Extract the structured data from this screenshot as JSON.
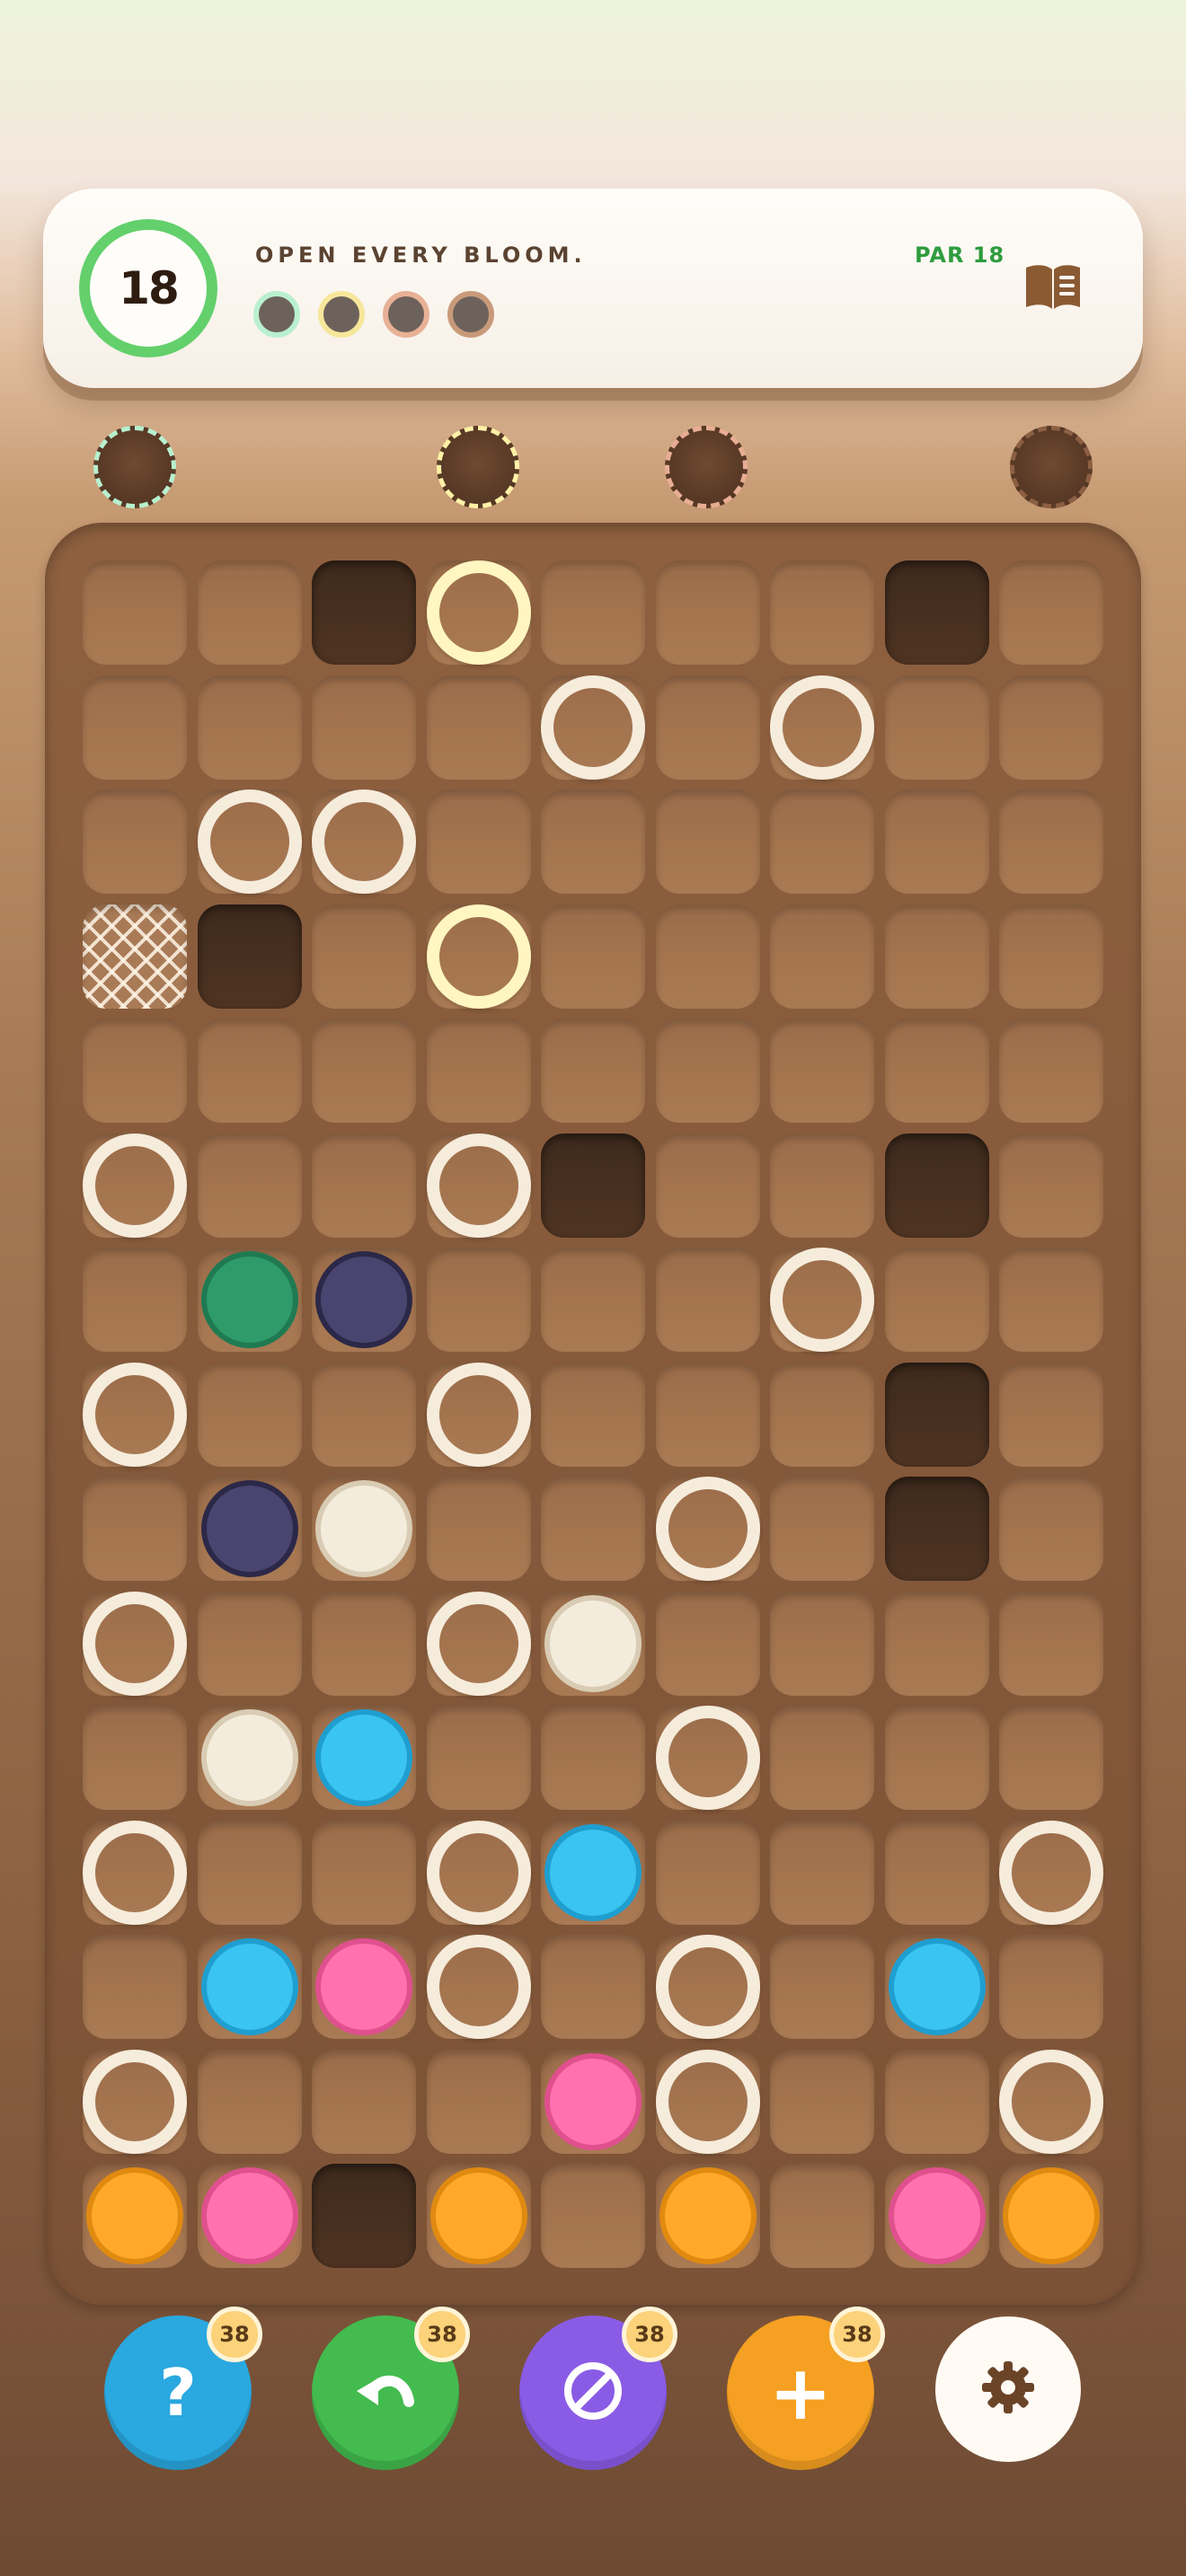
{
  "header": {
    "moves_left": "18",
    "goal_text": "OPEN EVERY BLOOM.",
    "par_text": "PAR 18"
  },
  "goal_dots": [
    {
      "border": "#b9f0cf"
    },
    {
      "border": "#f6e79a"
    },
    {
      "border": "#e8b196"
    },
    {
      "border": "#c89a7a"
    }
  ],
  "seed_slots": [
    {
      "border": "#b7f0cf"
    },
    {
      "border": "#fff1a6"
    },
    {
      "border": "#e8ad94"
    },
    {
      "border": "#8c5f43"
    }
  ],
  "colors": {
    "green_bloom": "#2f9a6a",
    "navy_bloom": "#4a4470",
    "cream_bloom": "#f3ecdd",
    "blue_bloom": "#3ac4f0",
    "pink_bloom": "#ff72ad",
    "orange_bloom": "#ffa92a",
    "ring": "#f6ecdc",
    "gold_ring": "#fff6c2"
  },
  "board": {
    "cols": 9,
    "rows": 15,
    "cells": [
      [
        "e",
        "e",
        "R",
        "G",
        "e",
        "e",
        "e",
        "R",
        "e"
      ],
      [
        "e",
        "e",
        "e",
        "e",
        "r",
        "e",
        "r",
        "e",
        "e"
      ],
      [
        "e",
        "r",
        "r",
        "e",
        "e",
        "e",
        "e",
        "e",
        "e"
      ],
      [
        "N",
        "R",
        "e",
        "G",
        "e",
        "e",
        "e",
        "e",
        "e"
      ],
      [
        "e",
        "e",
        "e",
        "e",
        "e",
        "e",
        "e",
        "e",
        "e"
      ],
      [
        "r",
        "e",
        "e",
        "r",
        "R",
        "e",
        "e",
        "R",
        "e"
      ],
      [
        "e",
        "green",
        "navy",
        "e",
        "e",
        "e",
        "r",
        "e",
        "e"
      ],
      [
        "r",
        "e",
        "e",
        "r",
        "e",
        "e",
        "e",
        "R",
        "e"
      ],
      [
        "e",
        "navy",
        "cream",
        "e",
        "e",
        "r",
        "e",
        "R",
        "e"
      ],
      [
        "r",
        "e",
        "e",
        "r",
        "cream",
        "e",
        "e",
        "e",
        "e"
      ],
      [
        "e",
        "cream",
        "blue",
        "e",
        "e",
        "r",
        "e",
        "e",
        "e"
      ],
      [
        "r",
        "e",
        "e",
        "r",
        "blue",
        "e",
        "e",
        "e",
        "r"
      ],
      [
        "e",
        "blue",
        "pink",
        "r",
        "e",
        "r",
        "e",
        "blue",
        "e"
      ],
      [
        "r",
        "e",
        "e",
        "e",
        "pink",
        "r",
        "e",
        "e",
        "r"
      ],
      [
        "orange",
        "pink",
        "R",
        "orange",
        "e",
        "orange",
        "e",
        "pink",
        "orange"
      ]
    ]
  },
  "buttons": [
    {
      "name": "hint",
      "icon": "question-icon",
      "glyph": "?",
      "count": "38",
      "color": "#2aa8e0"
    },
    {
      "name": "undo",
      "icon": "undo-icon",
      "glyph": "",
      "count": "38",
      "color": "#43bb4f"
    },
    {
      "name": "remove",
      "icon": "prohibit-icon",
      "glyph": "",
      "count": "38",
      "color": "#8a5ce6"
    },
    {
      "name": "add",
      "icon": "plus-icon",
      "glyph": "+",
      "count": "38",
      "color": "#f5a022"
    },
    {
      "name": "settings",
      "icon": "gear-icon"
    }
  ]
}
